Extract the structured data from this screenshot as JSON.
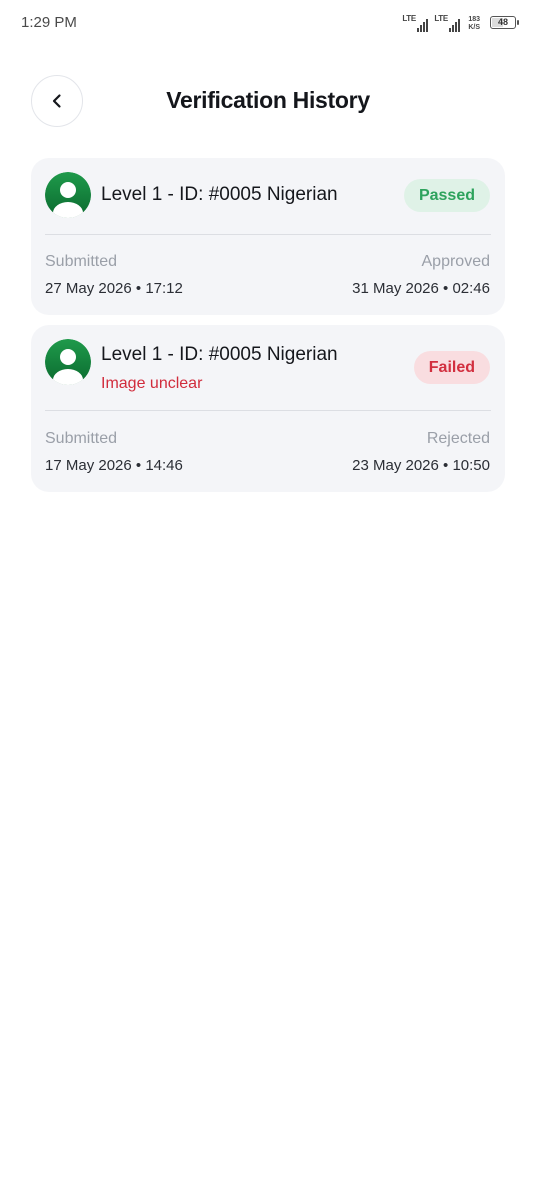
{
  "status_bar": {
    "time": "1:29 PM",
    "sim1": "LTE",
    "sim2": "LTE",
    "speed_value": "183",
    "speed_unit": "K/S",
    "battery": "48"
  },
  "header": {
    "back_icon": "chevron-left-icon",
    "title": "Verification History"
  },
  "records": [
    {
      "title": "Level 1 - ID: #0005 Nigerian",
      "status": "Passed",
      "status_color": "#2ea35d",
      "submitted_label": "Submitted",
      "submitted_value": "27 May 2026 • 17:12",
      "result_label": "Approved",
      "result_value": "31 May 2026 • 02:46"
    },
    {
      "title": "Level 1 - ID: #0005 Nigerian",
      "note": "Image unclear",
      "status": "Failed",
      "status_color": "#d22f3f",
      "submitted_label": "Submitted",
      "submitted_value": "17 May 2026 • 14:46",
      "result_label": "Rejected",
      "result_value": "23 May 2026 • 10:50"
    }
  ],
  "colors": {
    "card_background": "#f4f5f8",
    "avatar_green": "#0f7a3a",
    "error_text": "#d12c3c"
  }
}
